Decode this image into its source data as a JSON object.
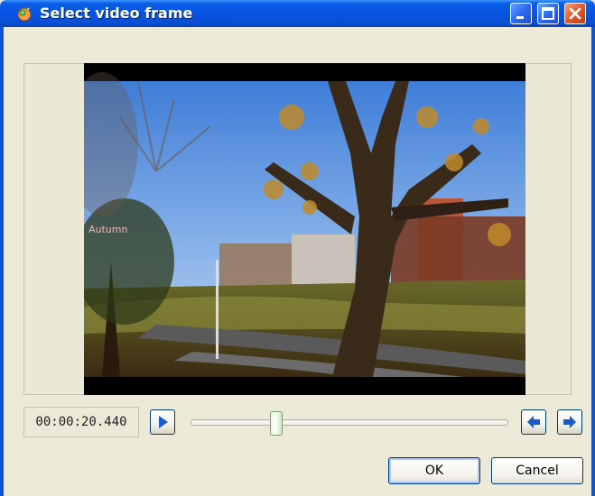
{
  "window": {
    "title": "Select video frame",
    "icon": "app-icon",
    "controls": [
      "minimize-icon",
      "maximize-icon",
      "close-icon"
    ]
  },
  "video": {
    "overlay_text": "Autumn"
  },
  "playback": {
    "timecode": "00:00:20.440",
    "position_fraction": 0.27
  },
  "buttons": {
    "ok": "OK",
    "cancel": "Cancel"
  },
  "colors": {
    "titlebar": "#0a55d8",
    "close": "#e15a2c",
    "accent": "#1c5cc9"
  }
}
